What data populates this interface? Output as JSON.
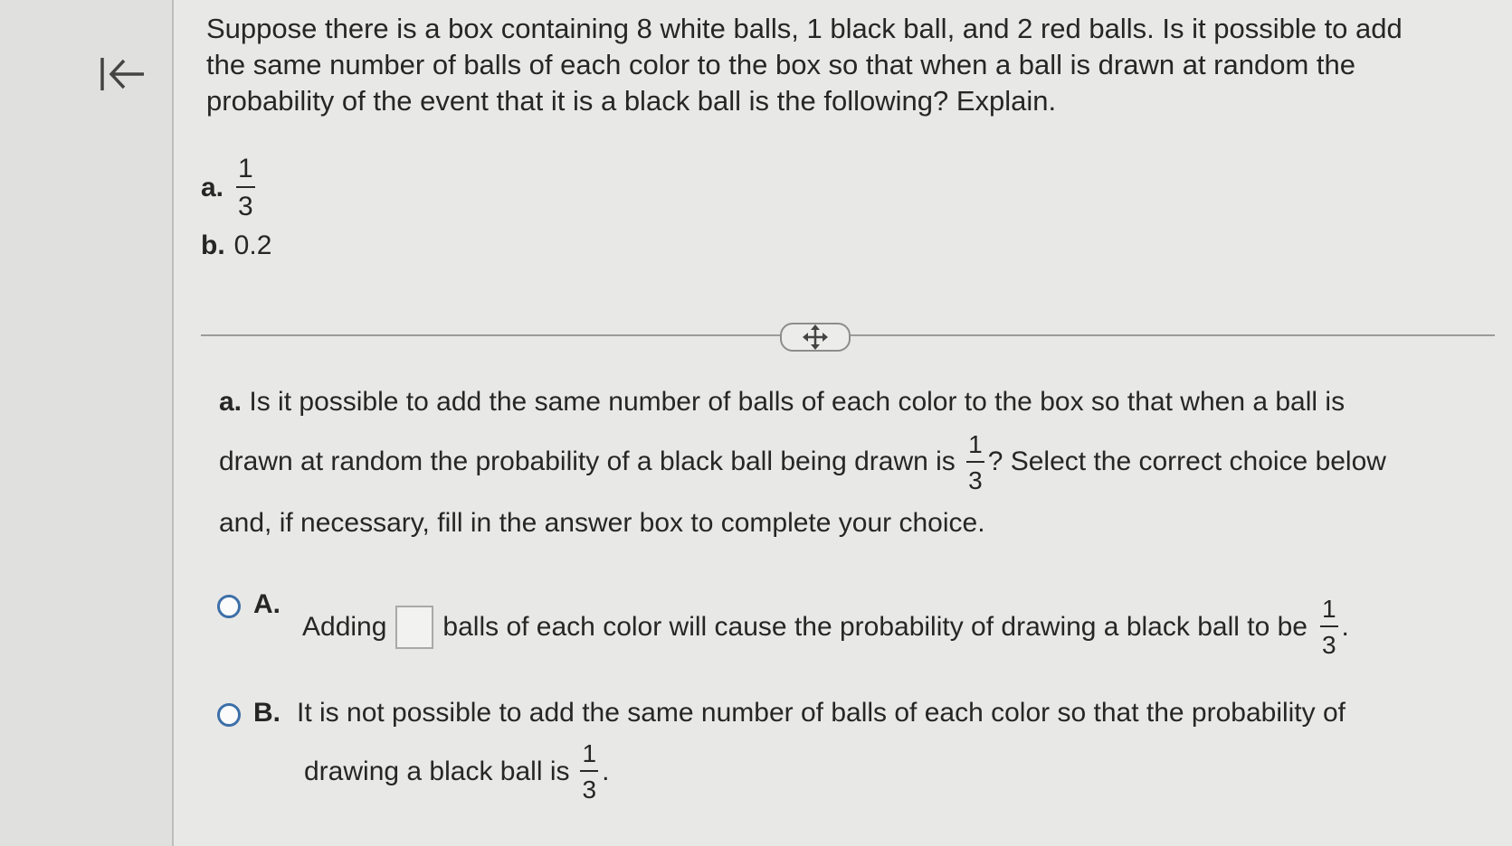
{
  "nav": {
    "back_icon": "back-to-start-icon"
  },
  "question": {
    "text": "Suppose there is a box containing 8 white balls, 1 black ball, and 2 red balls. Is it possible to add the same number of balls of each color to the box so that when a ball is drawn at random the probability of the event that it is a black ball is the following? Explain.",
    "part_a_label": "a.",
    "part_a_num": "1",
    "part_a_den": "3",
    "part_b_label": "b.",
    "part_b_value": "0.2"
  },
  "subquestion": {
    "label": "a.",
    "text_before": "Is it possible to add the same number of balls of each color to the box so that when a ball is drawn at random the probability of a black ball being drawn is",
    "frac_num": "1",
    "frac_den": "3",
    "text_after": "? Select the correct choice below and, if necessary, fill in the answer box to complete your choice."
  },
  "choices": {
    "a": {
      "letter": "A.",
      "before": "Adding",
      "after": "balls of each color will cause the probability of drawing a black ball to be",
      "frac_num": "1",
      "frac_den": "3",
      "end": "."
    },
    "b": {
      "letter": "B.",
      "line1": "It is not possible to add the same number of balls of each color so that the probability of",
      "line2": "drawing a black ball is",
      "frac_num": "1",
      "frac_den": "3",
      "end": "."
    }
  }
}
